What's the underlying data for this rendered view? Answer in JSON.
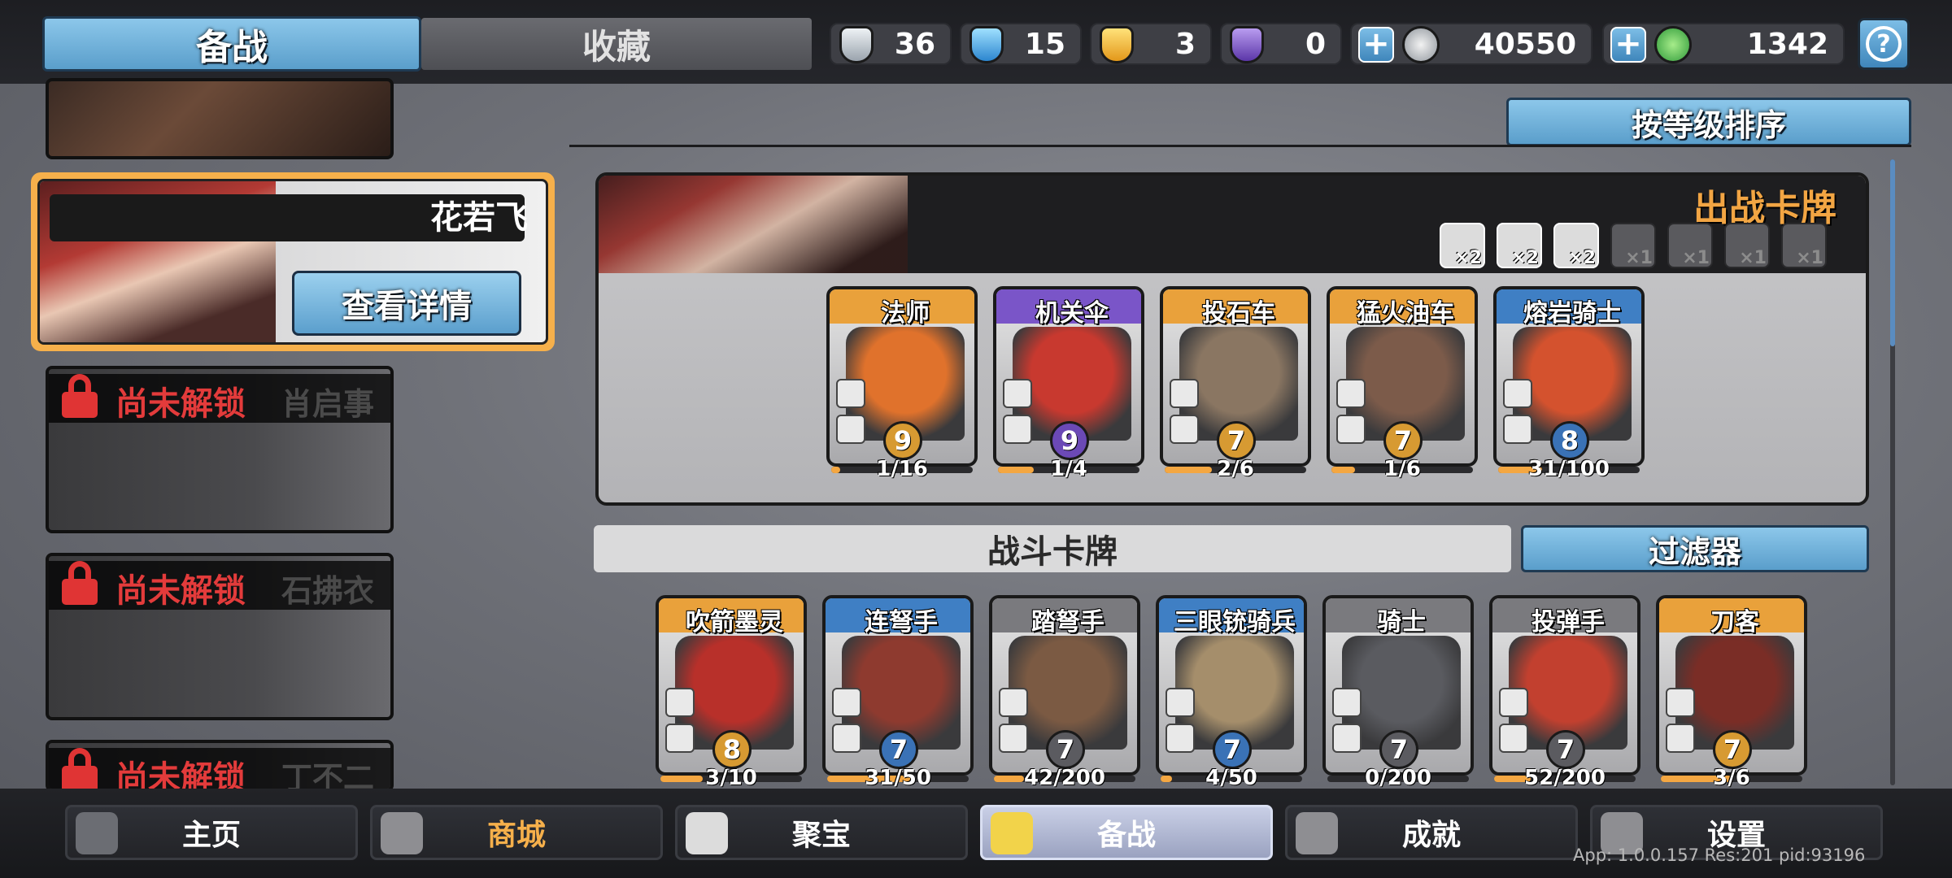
{
  "topbar": {
    "tab_prepare": "备战",
    "tab_collection": "收藏",
    "resources": [
      {
        "icon": "silver-shield-icon",
        "value": "36",
        "color": "#c9d0d8"
      },
      {
        "icon": "blue-crystal-icon",
        "value": "15",
        "color": "#5fb4e8"
      },
      {
        "icon": "gold-badge-icon",
        "value": "3",
        "color": "#f3b323"
      },
      {
        "icon": "purple-badge-icon",
        "value": "0",
        "color": "#8a5fd0"
      }
    ],
    "silver_coins": "40550",
    "jade": "1342",
    "help": "?"
  },
  "heroes": {
    "selected": {
      "name": "花若飞",
      "detail_label": "查看详情"
    },
    "locked_label": "尚未解锁",
    "locked": [
      {
        "name": "肖启事"
      },
      {
        "name": "石拂衣"
      },
      {
        "name": "丁不二"
      }
    ]
  },
  "controls": {
    "sort_label": "按等级排序",
    "filter_label": "过滤器",
    "battle_cards_title": "战斗卡牌"
  },
  "deck": {
    "title": "出战卡牌",
    "slots": [
      {
        "count": "×2",
        "active": true
      },
      {
        "count": "×2",
        "active": true
      },
      {
        "count": "×2",
        "active": true
      },
      {
        "count": "×1",
        "active": false
      },
      {
        "count": "×1",
        "active": false
      },
      {
        "count": "×1",
        "active": false
      },
      {
        "count": "×1",
        "active": false
      }
    ],
    "cards": [
      {
        "name": "法师",
        "level": "9",
        "progress": "1/16",
        "ratio": 0.0625,
        "rarity": "#e9a13b",
        "level_color": "#d79a32",
        "art": "#e0722c"
      },
      {
        "name": "机关伞",
        "level": "9",
        "progress": "1/4",
        "ratio": 0.25,
        "rarity": "#7a55c8",
        "level_color": "#6b49b6",
        "art": "#c8392f"
      },
      {
        "name": "投石车",
        "level": "7",
        "progress": "2/6",
        "ratio": 0.333,
        "rarity": "#e9a13b",
        "level_color": "#d79a32",
        "art": "#8a7662"
      },
      {
        "name": "猛火油车",
        "level": "7",
        "progress": "1/6",
        "ratio": 0.167,
        "rarity": "#e9a13b",
        "level_color": "#d79a32",
        "art": "#7c5b4a"
      },
      {
        "name": "熔岩骑士",
        "level": "8",
        "progress": "31/100",
        "ratio": 0.31,
        "rarity": "#3f7fc4",
        "level_color": "#3a72b6",
        "art": "#d4522e"
      }
    ]
  },
  "battle_cards": [
    {
      "name": "吹箭墨灵",
      "level": "8",
      "progress": "3/10",
      "ratio": 0.3,
      "rarity": "#e9a13b",
      "level_color": "#d79a32",
      "art": "#b8302a"
    },
    {
      "name": "连弩手",
      "level": "7",
      "progress": "31/50",
      "ratio": 0.62,
      "rarity": "#3f7fc4",
      "level_color": "#3a72b6",
      "art": "#8e3a2f"
    },
    {
      "name": "踏弩手",
      "level": "7",
      "progress": "42/200",
      "ratio": 0.21,
      "rarity": "#7a7a7e",
      "level_color": "#5b5b60",
      "art": "#7b5a43"
    },
    {
      "name": "三眼铳骑兵",
      "level": "7",
      "progress": "4/50",
      "ratio": 0.08,
      "rarity": "#3f7fc4",
      "level_color": "#3a72b6",
      "art": "#a58e6b"
    },
    {
      "name": "骑士",
      "level": "7",
      "progress": "0/200",
      "ratio": 0.0,
      "rarity": "#7a7a7e",
      "level_color": "#5b5b60",
      "art": "#5a5b60"
    },
    {
      "name": "投弹手",
      "level": "7",
      "progress": "52/200",
      "ratio": 0.26,
      "rarity": "#7a7a7e",
      "level_color": "#5b5b60",
      "art": "#c2402f"
    },
    {
      "name": "刀客",
      "level": "7",
      "progress": "3/6",
      "ratio": 0.5,
      "rarity": "#e9a13b",
      "level_color": "#d79a32",
      "art": "#7a2d26"
    }
  ],
  "nav": [
    {
      "label": "主页",
      "icon": "home-icon",
      "name": "nav-home"
    },
    {
      "label": "商城",
      "icon": "coins-icon",
      "name": "nav-shop"
    },
    {
      "label": "聚宝",
      "icon": "treasure-bowl-icon",
      "name": "nav-treasure"
    },
    {
      "label": "备战",
      "icon": "cards-icon",
      "name": "nav-prepare"
    },
    {
      "label": "成就",
      "icon": "achievement-grid-icon",
      "name": "nav-achievement"
    },
    {
      "label": "设置",
      "icon": "gear-icon",
      "name": "nav-settings"
    }
  ],
  "version": "App: 1.0.0.157 Res:201 pid:93196"
}
